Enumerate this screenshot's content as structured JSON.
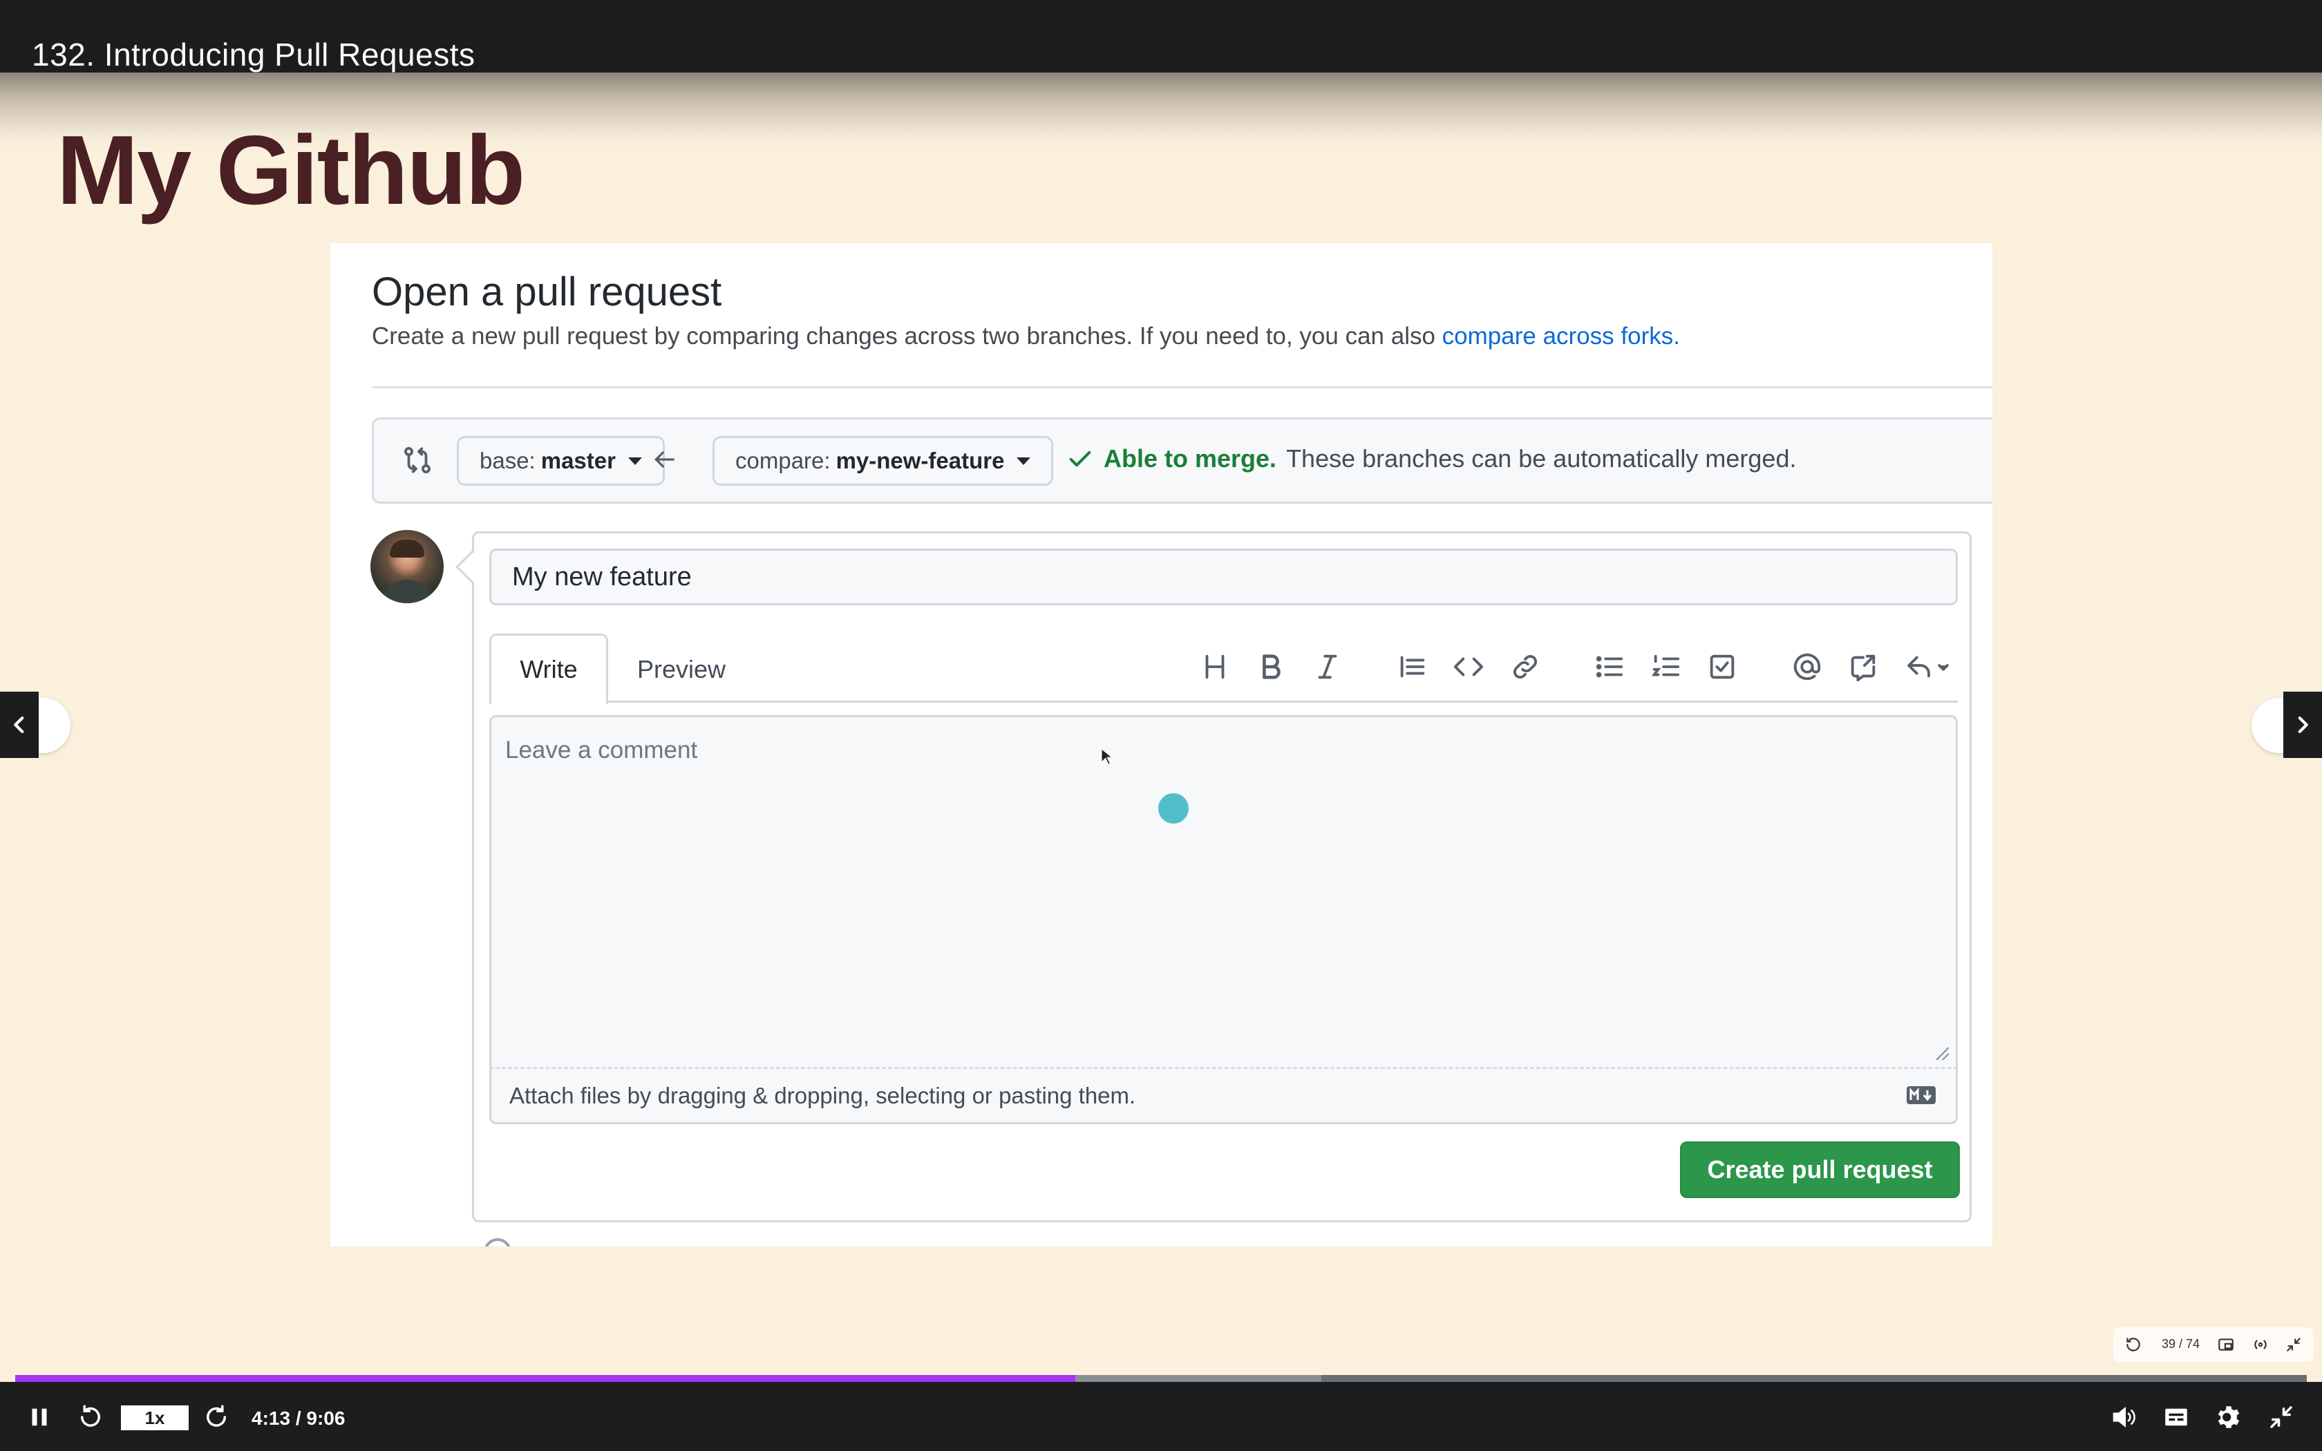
{
  "lecture": {
    "title": "132. Introducing Pull Requests"
  },
  "slide": {
    "heading": "My Github"
  },
  "github": {
    "page_title": "Open a pull request",
    "subtitle": "Create a new pull request by comparing changes across two branches. If you need to, you can also ",
    "subtitle_link": "compare across forks.",
    "base_branch": {
      "prefix": "base:",
      "value": "master"
    },
    "compare_branch": {
      "prefix": "compare:",
      "value": "my-new-feature"
    },
    "merge_status": {
      "ok_text": "Able to merge.",
      "detail": "These branches can be automatically merged."
    },
    "pr_title_value": "My new feature",
    "tabs": [
      {
        "label": "Write"
      },
      {
        "label": "Preview"
      }
    ],
    "toolbar_icons": [
      "heading-icon",
      "bold-icon",
      "italic-icon",
      "quote-icon",
      "code-icon",
      "link-icon",
      "bulleted-list-icon",
      "numbered-list-icon",
      "task-list-icon",
      "mention-icon",
      "cross-reference-icon",
      "reply-icon"
    ],
    "comment_placeholder": "Leave a comment",
    "attach_text": "Attach files by dragging & dropping, selecting or pasting them.",
    "create_button": "Create pull request"
  },
  "player": {
    "speed": "1x",
    "time": "4:13 / 9:06",
    "progress": 0.4625,
    "buffered": 0.57,
    "mini_overlay_text": "39 / 74",
    "accent_color": "#a435f0"
  }
}
